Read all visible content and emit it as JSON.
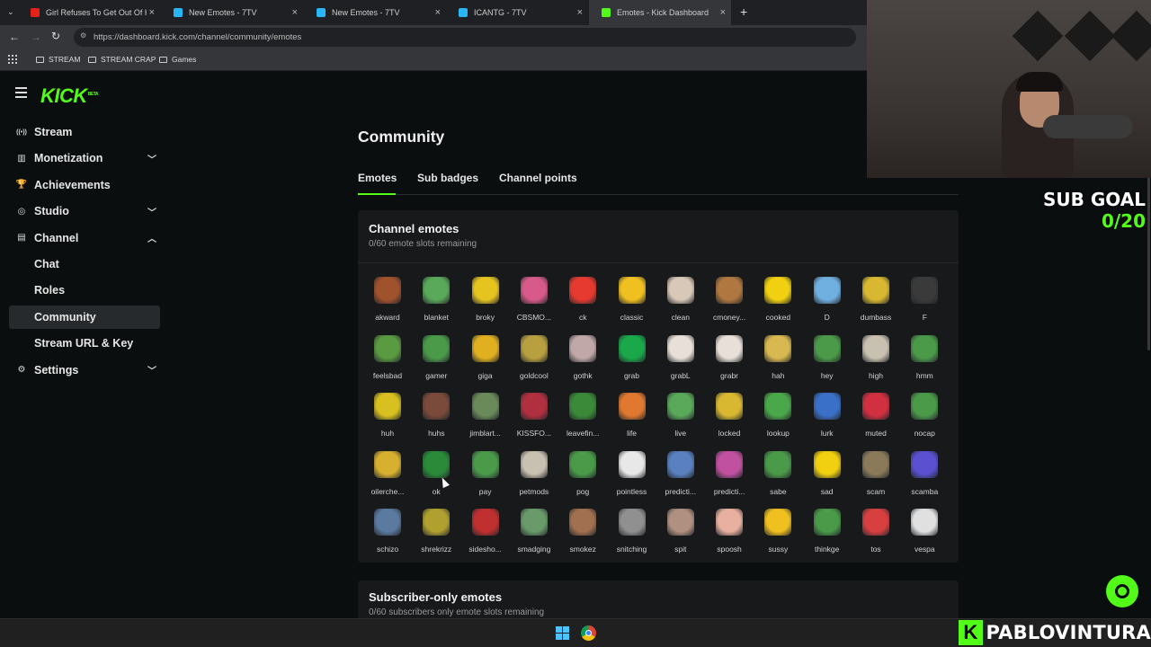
{
  "browser": {
    "tabs": [
      {
        "label": "Girl Refuses To Get Out Of Her",
        "fav_color": "#e62117"
      },
      {
        "label": "New Emotes - 7TV",
        "fav_color": "#29b6f6"
      },
      {
        "label": "New Emotes - 7TV",
        "fav_color": "#29b6f6"
      },
      {
        "label": "ICANTG - 7TV",
        "fav_color": "#29b6f6"
      },
      {
        "label": "Emotes - Kick Dashboard",
        "fav_color": "#53fc18"
      }
    ],
    "url": "https://dashboard.kick.com/channel/community/emotes",
    "bookmarks": [
      "STREAM",
      "STREAM CRAP",
      "Games"
    ]
  },
  "logo": {
    "text": "KICK",
    "badge": "BETA"
  },
  "sidebar": {
    "items": [
      {
        "label": "Stream",
        "icon": "broadcast-icon"
      },
      {
        "label": "Monetization",
        "icon": "chart-icon",
        "chevron": "down"
      },
      {
        "label": "Achievements",
        "icon": "trophy-icon"
      },
      {
        "label": "Studio",
        "icon": "studio-icon",
        "chevron": "down"
      },
      {
        "label": "Channel",
        "icon": "channel-icon",
        "chevron": "up"
      },
      {
        "label": "Chat",
        "sub": true
      },
      {
        "label": "Roles",
        "sub": true
      },
      {
        "label": "Community",
        "sub": true,
        "selected": true
      },
      {
        "label": "Stream URL & Key",
        "sub": true
      },
      {
        "label": "Settings",
        "icon": "gear-icon",
        "chevron": "down"
      }
    ]
  },
  "main": {
    "title": "Community",
    "tabs": [
      "Emotes",
      "Sub badges",
      "Channel points"
    ],
    "channel_emotes": {
      "title": "Channel emotes",
      "subtitle": "0/60 emote slots remaining",
      "emotes": [
        {
          "name": "akward",
          "color": "#a0522d"
        },
        {
          "name": "blanket",
          "color": "#5aa85a"
        },
        {
          "name": "broky",
          "color": "#e5c420"
        },
        {
          "name": "CBSMO...",
          "color": "#d75a8a"
        },
        {
          "name": "ck",
          "color": "#e63a30"
        },
        {
          "name": "classic",
          "color": "#f0c020"
        },
        {
          "name": "clean",
          "color": "#d8c8b8"
        },
        {
          "name": "cmoney...",
          "color": "#b07840"
        },
        {
          "name": "cooked",
          "color": "#f0d010"
        },
        {
          "name": "D",
          "color": "#70b0e0"
        },
        {
          "name": "dumbass",
          "color": "#d8b830"
        },
        {
          "name": "F",
          "color": "#3a3a3a"
        },
        {
          "name": "feelsbad",
          "color": "#5a9a40"
        },
        {
          "name": "gamer",
          "color": "#4a9a4a"
        },
        {
          "name": "giga",
          "color": "#e0b020"
        },
        {
          "name": "goldcool",
          "color": "#b8a040"
        },
        {
          "name": "gothk",
          "color": "#c0a8a8"
        },
        {
          "name": "grab",
          "color": "#1aa84a"
        },
        {
          "name": "grabL",
          "color": "#e8e0d8"
        },
        {
          "name": "grabr",
          "color": "#e8e0d8"
        },
        {
          "name": "hah",
          "color": "#d8b850"
        },
        {
          "name": "hey",
          "color": "#4a9a4a"
        },
        {
          "name": "high",
          "color": "#c8c0b0"
        },
        {
          "name": "hmm",
          "color": "#4a9a4a"
        },
        {
          "name": "huh",
          "color": "#d8c020"
        },
        {
          "name": "huhs",
          "color": "#7a4a3a"
        },
        {
          "name": "jimblart...",
          "color": "#6a8a5a"
        },
        {
          "name": "KISSFO...",
          "color": "#b03040"
        },
        {
          "name": "leavefin...",
          "color": "#3a8a3a"
        },
        {
          "name": "life",
          "color": "#e07830"
        },
        {
          "name": "live",
          "color": "#5aa85a"
        },
        {
          "name": "locked",
          "color": "#d8b830"
        },
        {
          "name": "lookup",
          "color": "#4aa84a"
        },
        {
          "name": "lurk",
          "color": "#3a70c8"
        },
        {
          "name": "muted",
          "color": "#d03040"
        },
        {
          "name": "nocap",
          "color": "#4a9a4a"
        },
        {
          "name": "oilerche...",
          "color": "#d8b030"
        },
        {
          "name": "ok",
          "color": "#2a8a3a"
        },
        {
          "name": "pay",
          "color": "#4a9a4a"
        },
        {
          "name": "petmods",
          "color": "#c8c0b0"
        },
        {
          "name": "pog",
          "color": "#4a9a4a"
        },
        {
          "name": "pointless",
          "color": "#e8e8e8"
        },
        {
          "name": "predicti...",
          "color": "#5a80c0"
        },
        {
          "name": "predicti...",
          "color": "#c050a0"
        },
        {
          "name": "sabe",
          "color": "#4a9a4a"
        },
        {
          "name": "sad",
          "color": "#f0d010"
        },
        {
          "name": "scam",
          "color": "#8a7a5a"
        },
        {
          "name": "scamba",
          "color": "#5a50d0"
        },
        {
          "name": "schizo",
          "color": "#5a7aa0"
        },
        {
          "name": "shrekrizz",
          "color": "#b0a030"
        },
        {
          "name": "sidesho...",
          "color": "#c03030"
        },
        {
          "name": "smadging",
          "color": "#6a9a6a"
        },
        {
          "name": "smokez",
          "color": "#a07050"
        },
        {
          "name": "snitching",
          "color": "#909090"
        },
        {
          "name": "spit",
          "color": "#b09080"
        },
        {
          "name": "spoosh",
          "color": "#e8b0a0"
        },
        {
          "name": "sussy",
          "color": "#f0c020"
        },
        {
          "name": "thinkge",
          "color": "#4a9a4a"
        },
        {
          "name": "tos",
          "color": "#d84040"
        },
        {
          "name": "vespa",
          "color": "#e0e0e0"
        }
      ]
    },
    "sub_emotes": {
      "title": "Subscriber-only emotes",
      "subtitle": "0/60 subscribers only emote slots remaining"
    }
  },
  "overlay": {
    "sub_goal_label": "SUB GOAL",
    "sub_goal_value": "0/20",
    "brand": "PABLOVINTURA",
    "brand_mark": "K"
  },
  "colors": {
    "accent": "#53fc18"
  }
}
